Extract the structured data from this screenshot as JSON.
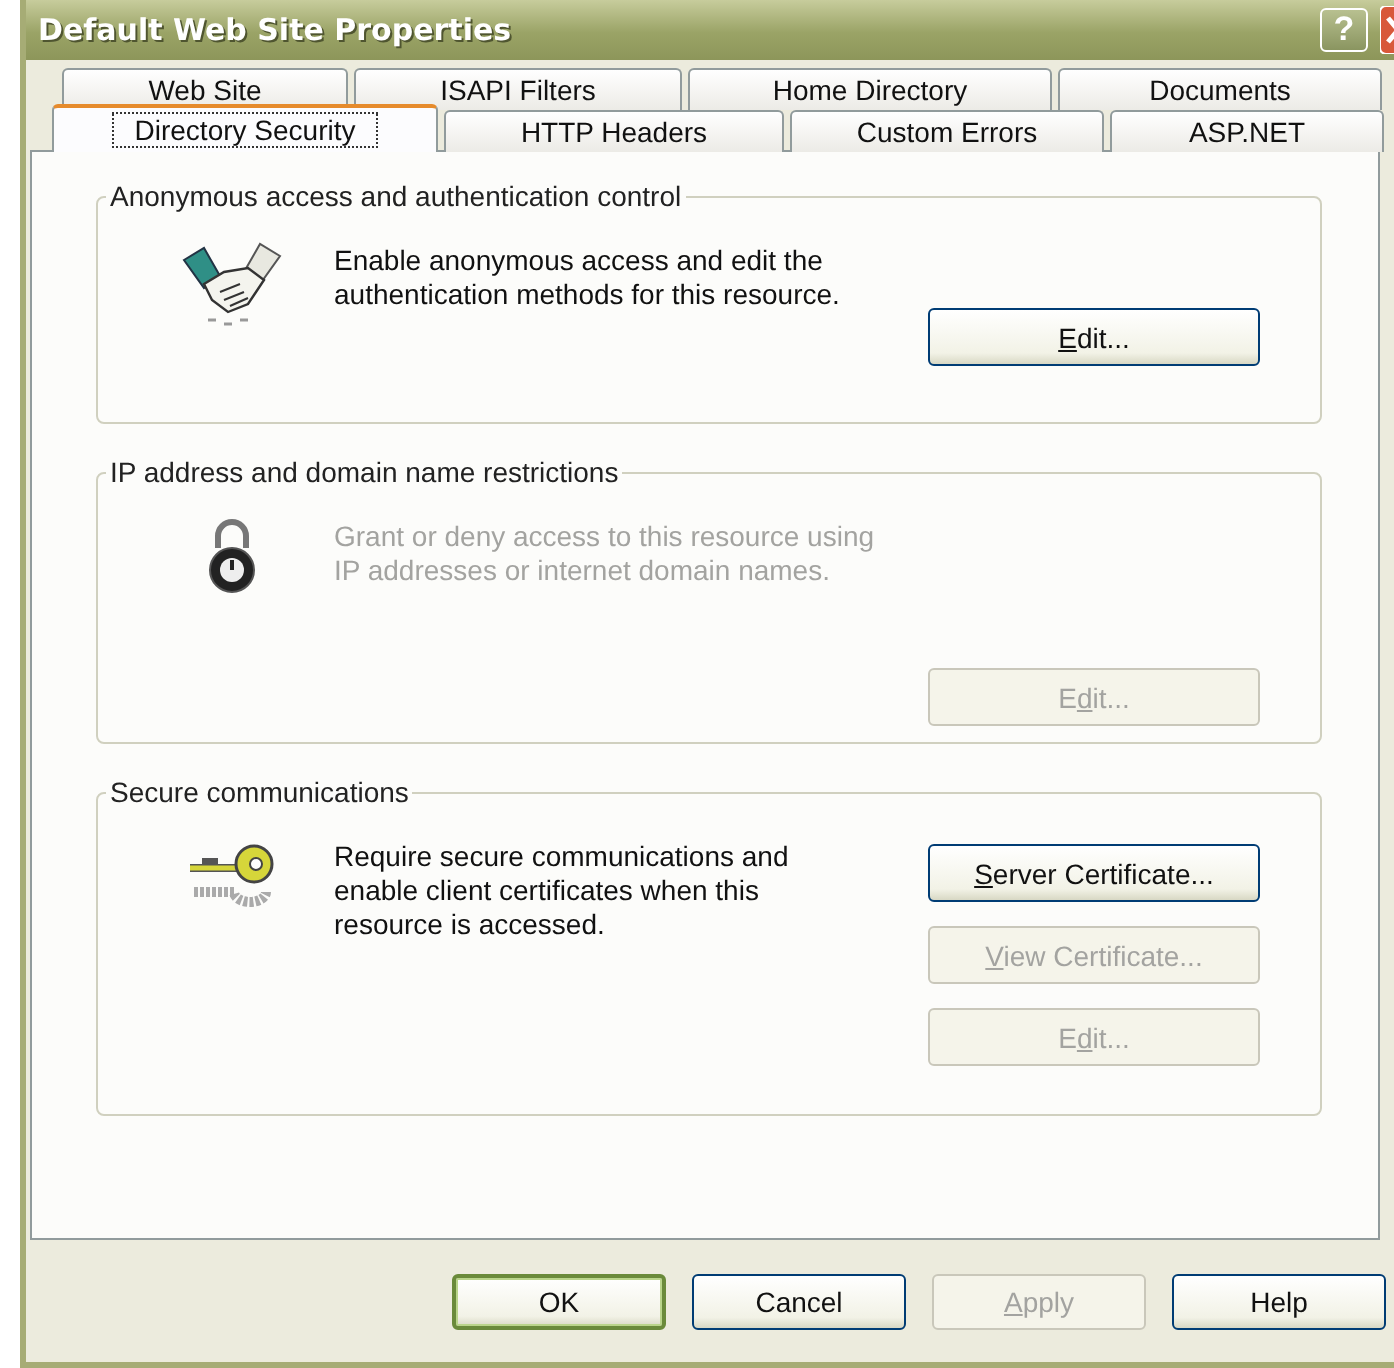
{
  "window": {
    "title": "Default Web Site Properties",
    "help_button": "?"
  },
  "tab_rows": [
    {
      "tabs": [
        {
          "label": "Web Site",
          "selected": false
        },
        {
          "label": "ISAPI Filters",
          "selected": false
        },
        {
          "label": "Home Directory",
          "selected": false
        },
        {
          "label": "Documents",
          "selected": false
        }
      ]
    },
    {
      "tabs": [
        {
          "label": "Directory Security",
          "selected": true
        },
        {
          "label": "HTTP Headers",
          "selected": false
        },
        {
          "label": "Custom Errors",
          "selected": false
        },
        {
          "label": "ASP.NET",
          "selected": false
        }
      ]
    }
  ],
  "groups": [
    {
      "title": "Anonymous access and authentication control",
      "kind": "handshake",
      "enabled": true,
      "description": "Enable anonymous access and edit the authentication methods for this resource.",
      "buttons": [
        {
          "access_key": "E",
          "label_after": "dit...",
          "disabled": false
        }
      ]
    },
    {
      "title": "IP address and domain name restrictions",
      "kind": "padlock",
      "enabled": false,
      "description": "Grant or deny access to this resource using IP addresses or internet domain names.",
      "buttons": [
        {
          "label_before": "E",
          "access_key": "d",
          "label_after": "it...",
          "disabled": true
        }
      ]
    },
    {
      "title": "Secure communications",
      "kind": "key",
      "enabled": true,
      "description": "Require secure communications and enable client certificates when this resource is accessed.",
      "buttons": [
        {
          "access_key": "S",
          "label_after": "erver Certificate...",
          "disabled": false
        },
        {
          "access_key": "V",
          "label_after": "iew Certificate...",
          "disabled": true
        },
        {
          "label_before": "E",
          "access_key": "d",
          "label_after": "it...",
          "disabled": true
        }
      ]
    }
  ],
  "dialog_buttons": [
    {
      "label_before": "OK",
      "default": true,
      "disabled": false
    },
    {
      "label_before": "Cancel",
      "default": false,
      "disabled": false
    },
    {
      "access_key": "A",
      "label_after": "pply",
      "default": false,
      "disabled": true
    },
    {
      "label_before": "Help",
      "default": false,
      "disabled": false
    }
  ]
}
